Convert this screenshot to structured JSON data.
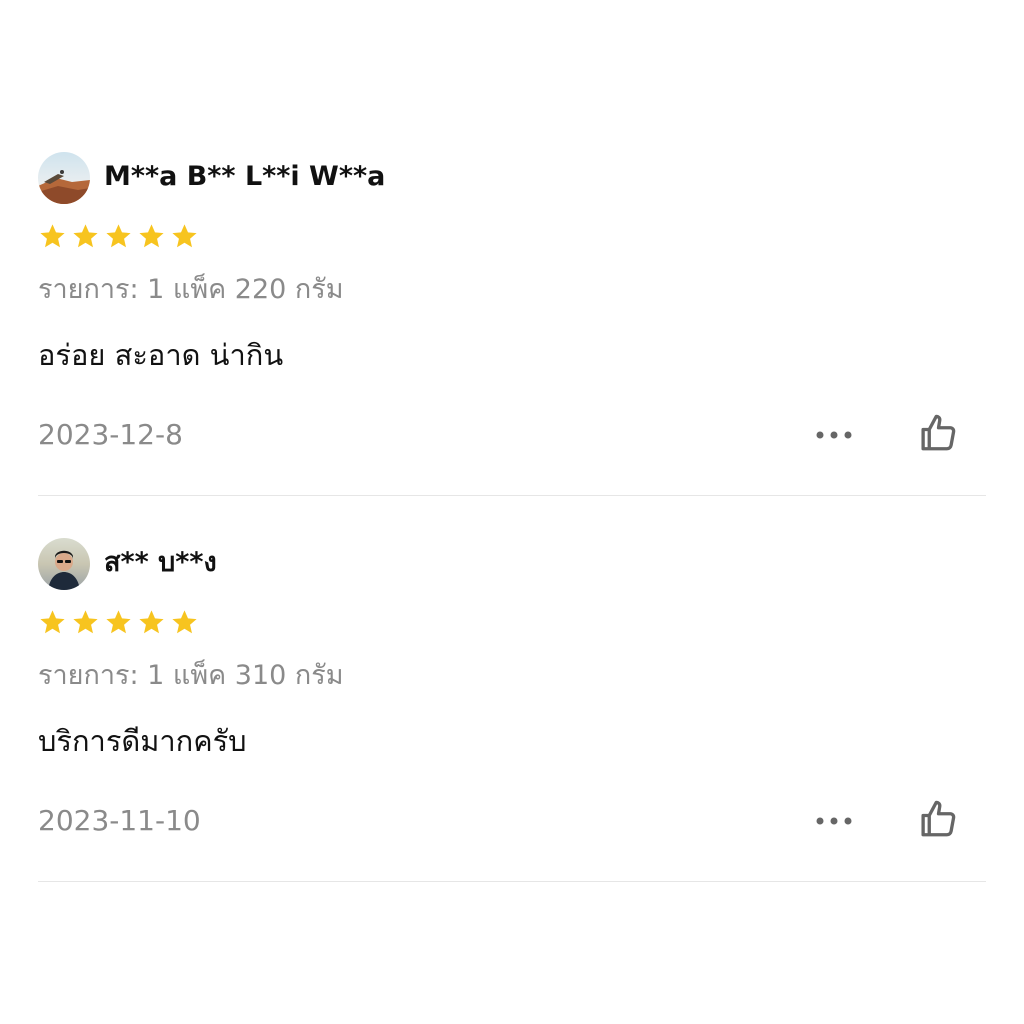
{
  "colors": {
    "star": "#F7C41F",
    "muted_text": "#8a8a8a",
    "primary_text": "#111111",
    "divider": "#e6e6e6",
    "icon": "#666666"
  },
  "icons": {
    "star": "star-icon",
    "more": "more-dots-icon",
    "like": "thumbs-up-icon"
  },
  "reviews": [
    {
      "username": "M**a B** L**i W**a",
      "rating": 5,
      "variant": "รายการ: 1 แพ็ค 220 กรัม",
      "comment": "อร่อย สะอาด น่ากิน",
      "date": "2023-12-8"
    },
    {
      "username": "ส** บ**ง",
      "rating": 5,
      "variant": "รายการ: 1 แพ็ค 310 กรัม",
      "comment": "บริการดีมากครับ",
      "date": "2023-11-10"
    }
  ]
}
